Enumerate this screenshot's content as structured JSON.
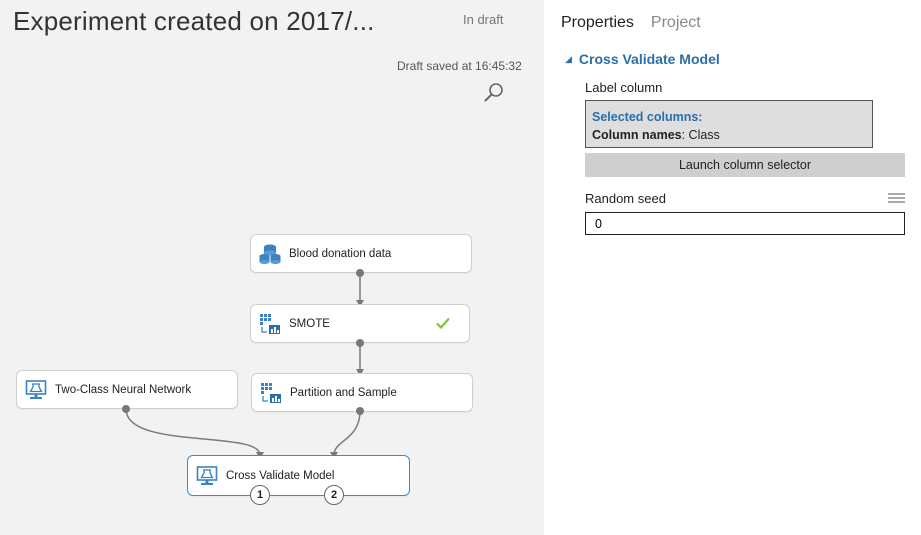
{
  "canvas": {
    "title": "Experiment created on 2017/...",
    "draft_status": "In draft",
    "draft_saved": "Draft saved at 16:45:32",
    "modules": [
      {
        "label": "Blood donation data",
        "icon": "dataset-icon"
      },
      {
        "label": "SMOTE",
        "icon": "transform-module-icon",
        "status": "check-icon"
      },
      {
        "label": "Two-Class Neural Network",
        "icon": "model-monitor-icon"
      },
      {
        "label": "Partition and Sample",
        "icon": "transform-module-icon"
      },
      {
        "label": "Cross Validate Model",
        "icon": "model-monitor-icon",
        "selected": true
      }
    ],
    "ports": [
      "1",
      "2"
    ]
  },
  "properties": {
    "tabs": [
      "Properties",
      "Project"
    ],
    "section": "Cross Validate Model",
    "label_column": {
      "label": "Label column",
      "selected_title": "Selected columns:",
      "names_label": "Column names",
      "names_value": ": Class"
    },
    "launch_button": "Launch column selector",
    "random_seed": {
      "label": "Random seed",
      "value": "0"
    }
  },
  "colors": {
    "accent": "#2a6fa8",
    "selected_border": "#3a8bc6",
    "check": "#7cc340",
    "canvas_bg": "#f2f2f2"
  }
}
